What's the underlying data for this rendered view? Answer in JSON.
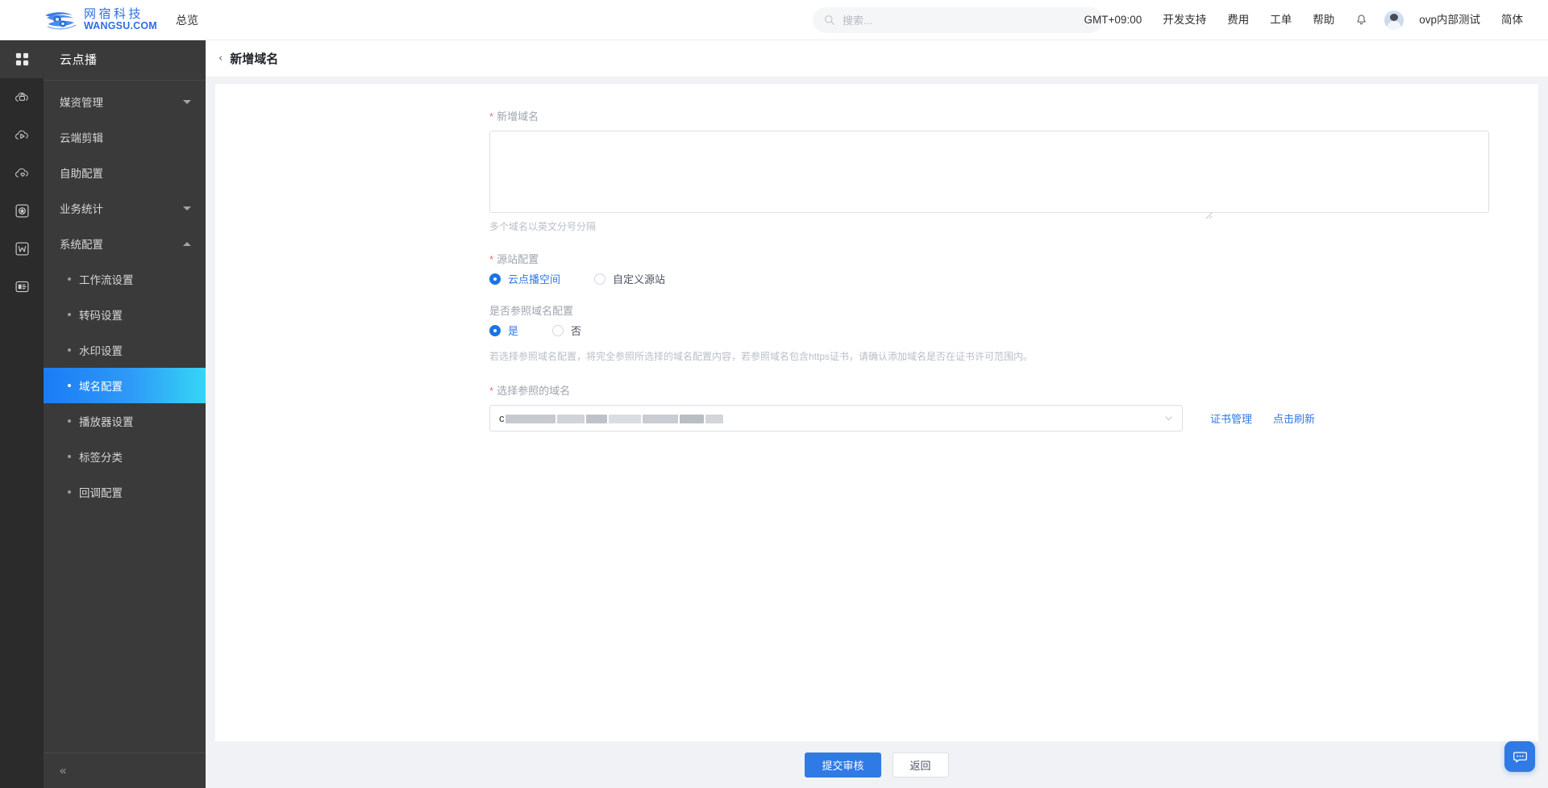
{
  "header": {
    "brand_cn": "网宿科技",
    "brand_en": "WANGSU.COM",
    "nav_overview": "总览",
    "search_placeholder": "搜索...",
    "search_value": "",
    "right_items": [
      {
        "label": "GMT+09:00",
        "name": "timezone"
      },
      {
        "label": "开发支持",
        "name": "dev-support"
      },
      {
        "label": "费用",
        "name": "billing"
      },
      {
        "label": "工单",
        "name": "tickets"
      },
      {
        "label": "帮助",
        "name": "help"
      }
    ],
    "user_name": "ovp内部测试",
    "language": "简体"
  },
  "sidebar": {
    "title": "云点播",
    "collapse_icon": "«",
    "items": [
      {
        "label": "媒资管理",
        "expandable": true,
        "expanded": false
      },
      {
        "label": "云端剪辑",
        "expandable": false
      },
      {
        "label": "自助配置",
        "expandable": false
      },
      {
        "label": "业务统计",
        "expandable": true,
        "expanded": false
      },
      {
        "label": "系统配置",
        "expandable": true,
        "expanded": true
      }
    ],
    "sub_items": [
      {
        "label": "工作流设置",
        "active": false
      },
      {
        "label": "转码设置",
        "active": false
      },
      {
        "label": "水印设置",
        "active": false
      },
      {
        "label": "域名配置",
        "active": true
      },
      {
        "label": "播放器设置",
        "active": false
      },
      {
        "label": "标签分类",
        "active": false
      },
      {
        "label": "回调配置",
        "active": false
      }
    ]
  },
  "page": {
    "title": "新增域名",
    "back_icon": "‹"
  },
  "form": {
    "domain": {
      "label": "新增域名",
      "required": true,
      "value": "",
      "placeholder": "",
      "hint": "多个域名以英文分号分隔"
    },
    "origin": {
      "label": "源站配置",
      "required": true,
      "options": [
        {
          "label": "云点播空间",
          "selected": true
        },
        {
          "label": "自定义源站",
          "selected": false
        }
      ]
    },
    "reference": {
      "label": "是否参照域名配置",
      "required": false,
      "options": [
        {
          "label": "是",
          "selected": true
        },
        {
          "label": "否",
          "selected": false
        }
      ],
      "description": "若选择参照域名配置，将完全参照所选择的域名配置内容，若参照域名包含https证书，请确认添加域名是否在证书许可范围内。"
    },
    "ref_domain": {
      "label": "选择参照的域名",
      "required": true,
      "value_prefix": "c",
      "value_redacted": true,
      "links": [
        {
          "label": "证书管理",
          "name": "certificate-management-link"
        },
        {
          "label": "点击刷新",
          "name": "refresh-link"
        }
      ]
    }
  },
  "footer": {
    "submit_label": "提交审核",
    "back_label": "返回"
  },
  "colors": {
    "accent": "#2f7ae5",
    "active_gradient_start": "#1a7cf5",
    "active_gradient_end": "#35d6f5",
    "required_star": "#f56c6c",
    "sidebar_bg": "#3a3a3a",
    "rail_bg": "#2b2b2b"
  }
}
